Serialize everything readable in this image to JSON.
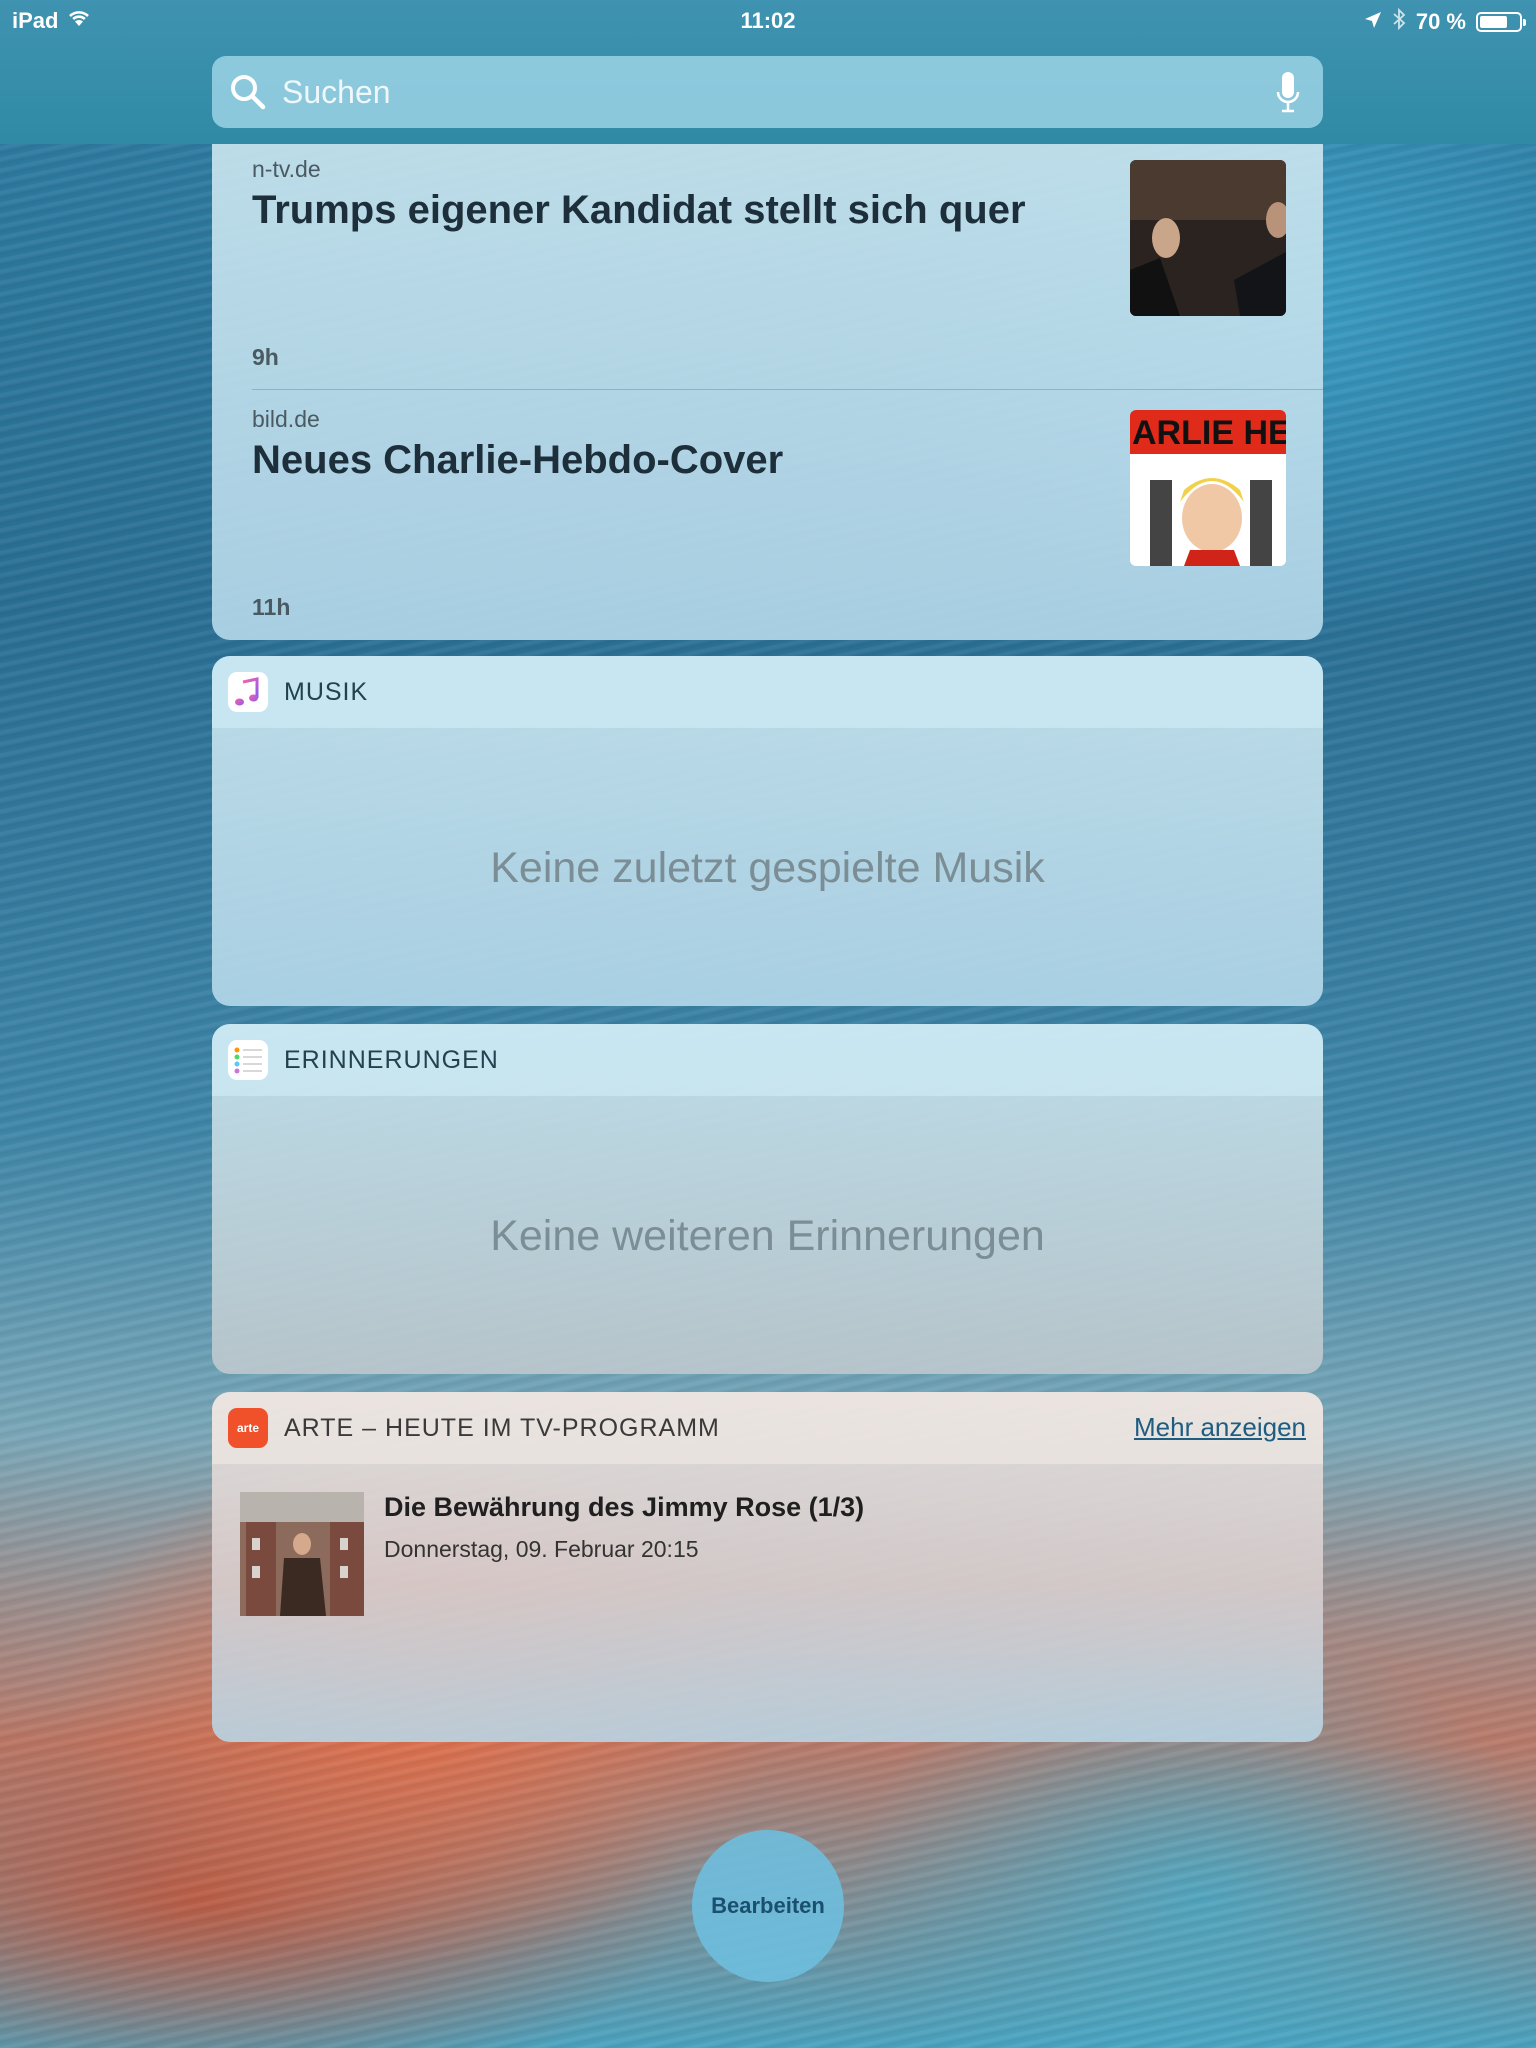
{
  "statusbar": {
    "device": "iPad",
    "time": "11:02",
    "battery": "70 %",
    "battery_level": 0.7
  },
  "search": {
    "placeholder": "Suchen"
  },
  "news": [
    {
      "source": "n-tv.de",
      "title": "Trumps eigener Kandidat stellt sich quer",
      "age": "9h"
    },
    {
      "source": "bild.de",
      "title": "Neues Charlie-Hebdo-Cover",
      "age": "11h",
      "thumb_text": "ARLIE HEB"
    }
  ],
  "musik": {
    "title": "MUSIK",
    "empty": "Keine zuletzt gespielte Musik"
  },
  "erinnerungen": {
    "title": "ERINNERUNGEN",
    "empty": "Keine weiteren Erinnerungen"
  },
  "arte": {
    "title": "ARTE – HEUTE IM TV-PROGRAMM",
    "icon_text": "arte",
    "more": "Mehr anzeigen",
    "program_title": "Die Bewährung des Jimmy Rose (1/3)",
    "program_time": "Donnerstag, 09. Februar 20:15"
  },
  "edit_button": "Bearbeiten",
  "colors": {
    "arte_orange": "#f0502a",
    "link_blue": "#1e5d82"
  }
}
